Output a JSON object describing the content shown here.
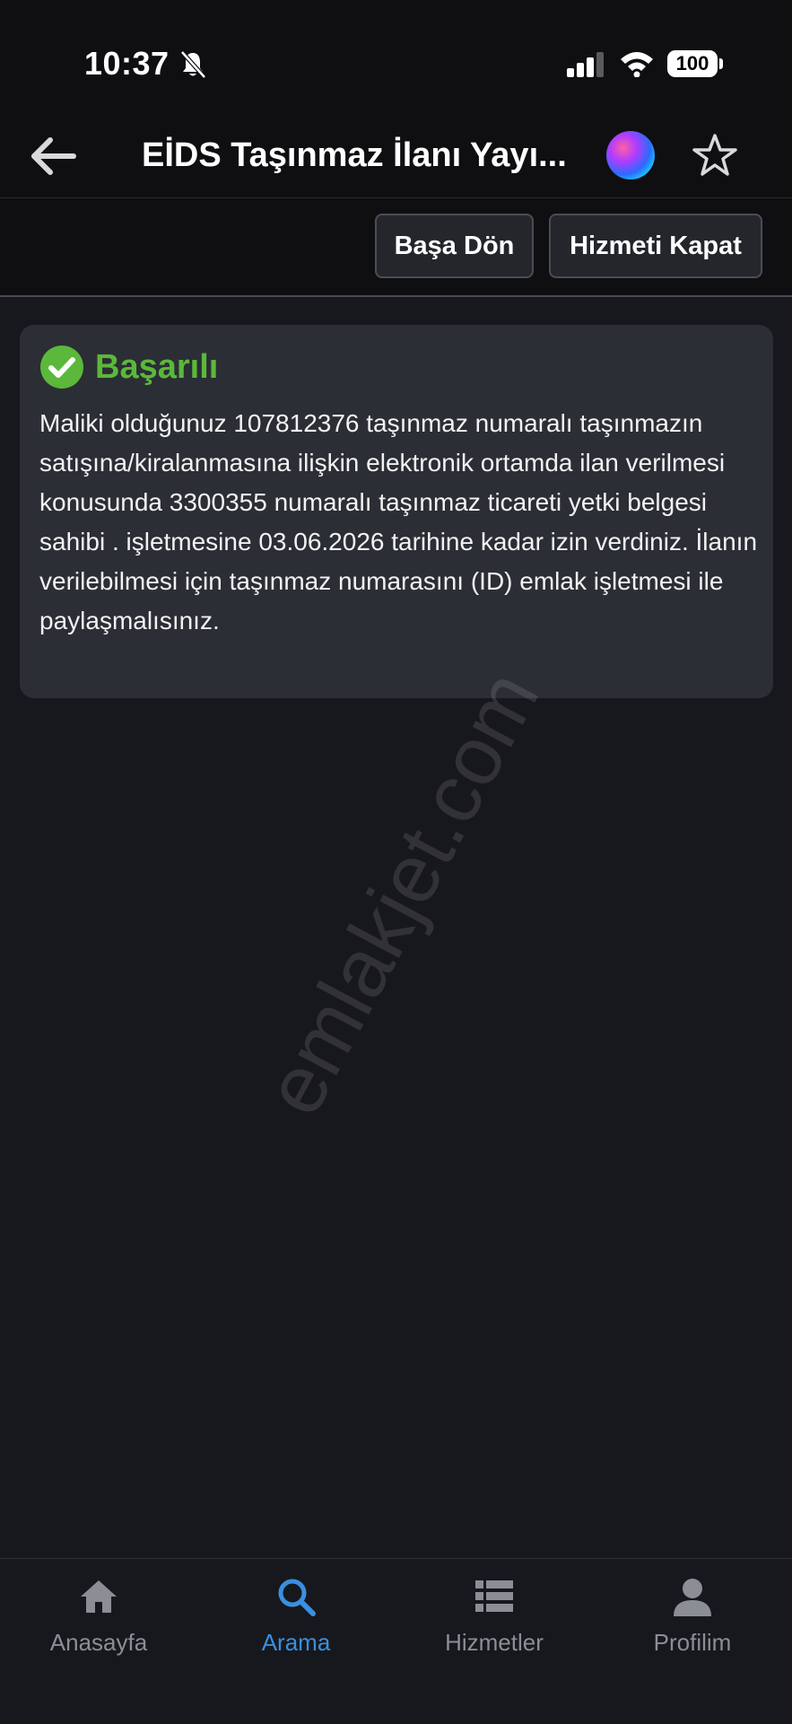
{
  "status_bar": {
    "time": "10:37",
    "battery": "100"
  },
  "nav": {
    "title": "EİDS Taşınmaz İlanı Yayı..."
  },
  "toolbar": {
    "restart_label": "Başa Dön",
    "close_label": "Hizmeti Kapat"
  },
  "result": {
    "title": "Başarılı",
    "message": "Maliki olduğunuz 107812376 taşınmaz numaralı taşınmazın satışına/kiralanmasına ilişkin elektronik ortamda ilan verilmesi konusunda 3300355 numaralı taşınmaz ticareti yetki belgesi sahibi . işletmesine 03.06.2026 tarihine kadar izin verdiniz. İlanın verilebilmesi için taşınmaz numarasını (ID) emlak işletmesi ile paylaşmalısınız.",
    "accent_color": "#5bb83a"
  },
  "watermark": "emlakjet.com",
  "tabs": [
    {
      "label": "Anasayfa",
      "icon": "home-icon",
      "active": false
    },
    {
      "label": "Arama",
      "icon": "search-icon",
      "active": true
    },
    {
      "label": "Hizmetler",
      "icon": "list-icon",
      "active": false
    },
    {
      "label": "Profilim",
      "icon": "user-icon",
      "active": false
    }
  ],
  "colors": {
    "background": "#17181d",
    "active_tab": "#3a8fe0"
  }
}
